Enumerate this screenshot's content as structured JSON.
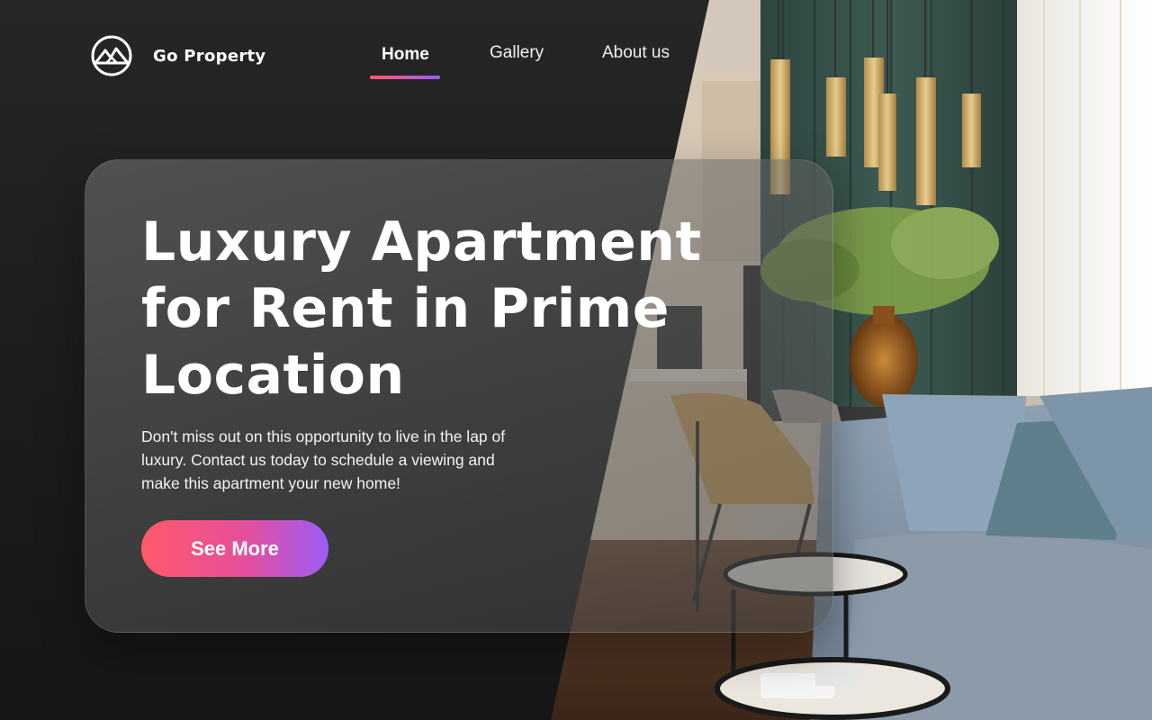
{
  "header": {
    "brand": "Go Property",
    "logo_icon": "mountain-logo-icon",
    "nav": [
      {
        "label": "Home",
        "active": true
      },
      {
        "label": "Gallery",
        "active": false
      },
      {
        "label": "About us",
        "active": false
      }
    ]
  },
  "hero": {
    "title": "Luxury Apartment for Rent in Prime Location",
    "description": "Don't miss out on this opportunity to live in the lap of luxury. Contact us today to schedule a viewing and make this apartment your new home!",
    "cta_label": "See More"
  },
  "colors": {
    "accent_start": "#ff5a6a",
    "accent_end": "#9b5cf6",
    "panel": "#1d1d1d"
  }
}
